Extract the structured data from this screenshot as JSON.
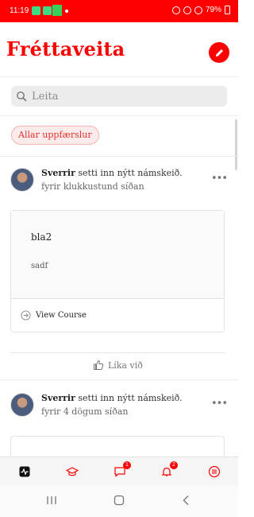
{
  "status_bar": {
    "time": "11:19",
    "battery": "79%"
  },
  "header": {
    "title": "Fréttaveita"
  },
  "search": {
    "placeholder": "Leita"
  },
  "filter": {
    "label": "Allar uppfærslur"
  },
  "posts": [
    {
      "author": "Sverrir",
      "action": " setti inn nýtt námskeið.",
      "time": "fyrir klukkustund síðan",
      "course": {
        "title": "bla2",
        "description": "sadf",
        "link_label": "View Course"
      },
      "like_label": "Líka við"
    },
    {
      "author": "Sverrir",
      "action": " setti inn nýtt námskeið.",
      "time": "fyrir 4 dögum síðan"
    }
  ],
  "tabbar": {
    "chat_badge": "1",
    "notifications_badge": "2"
  },
  "colors": {
    "accent": "#ff0000",
    "chip_bg": "#fdeaea",
    "chip_text": "#e0342f"
  }
}
